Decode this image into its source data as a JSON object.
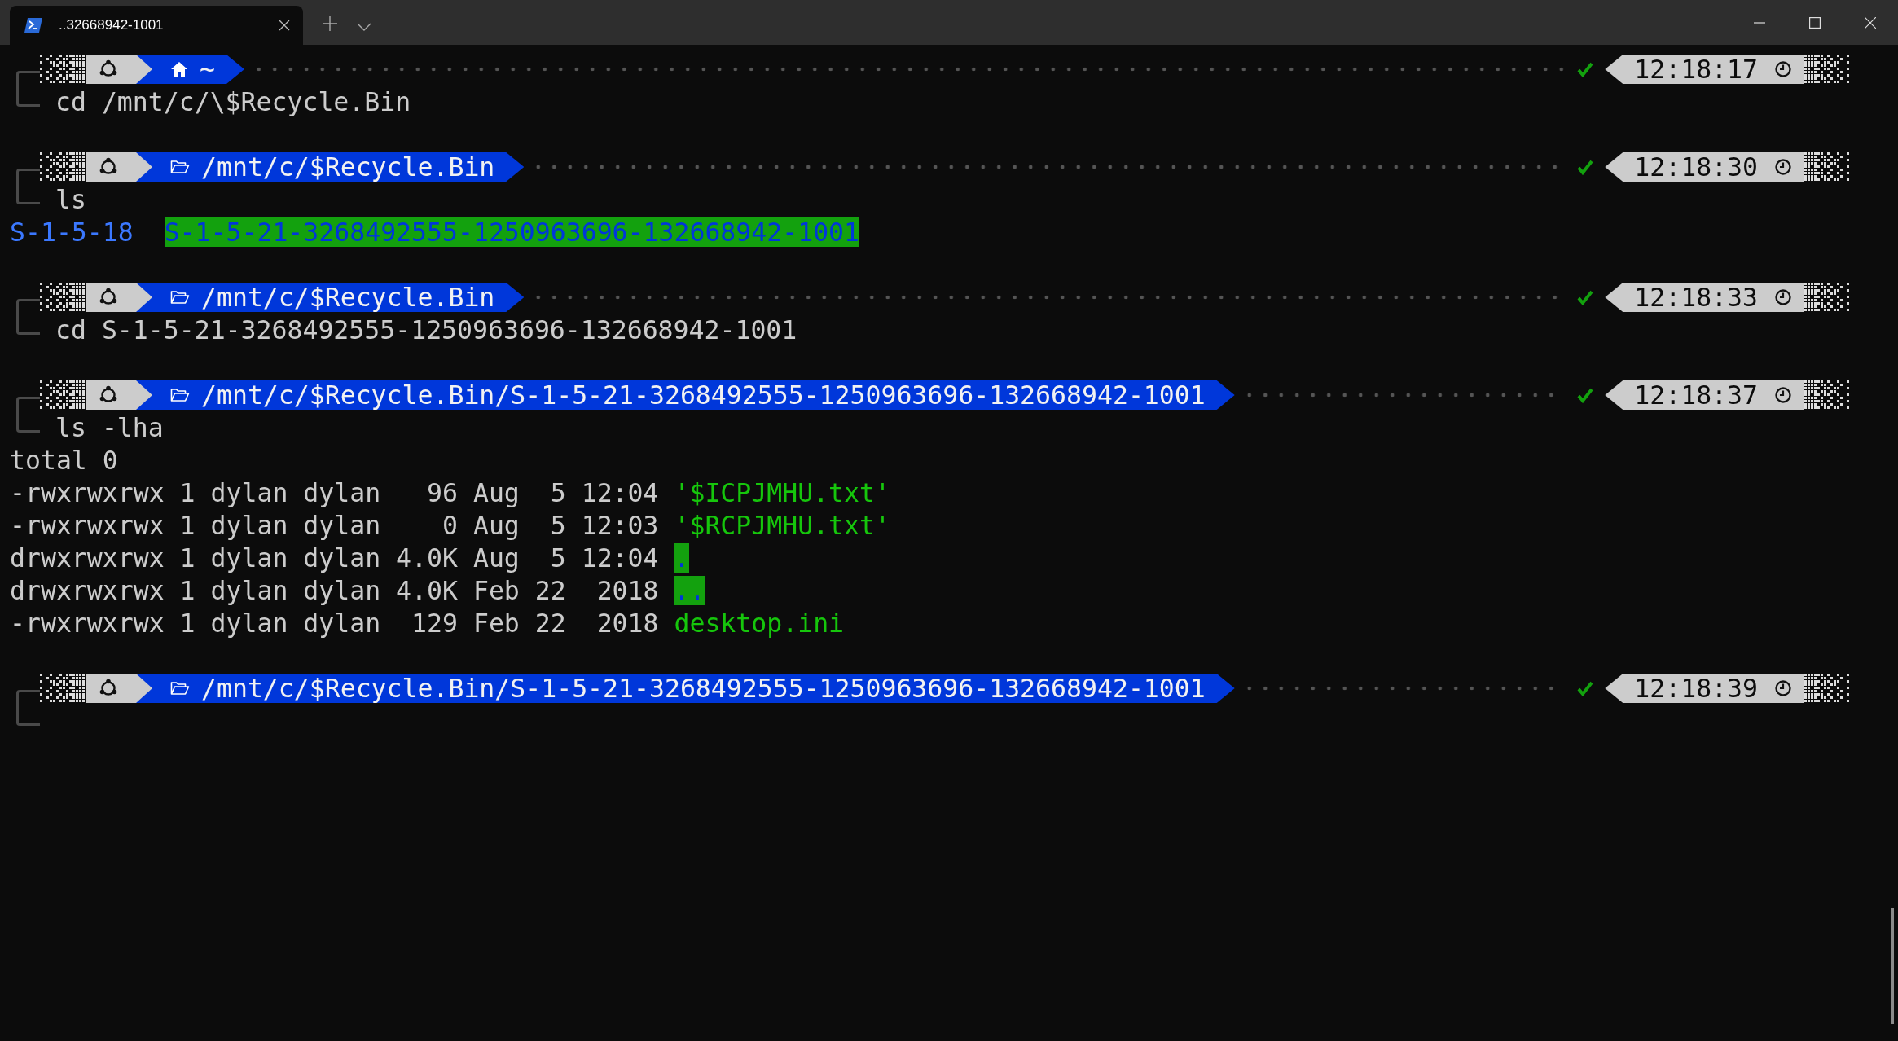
{
  "tab": {
    "title": "..32668942-1001"
  },
  "blocks": [
    {
      "location": {
        "kind": "home",
        "text": "~"
      },
      "success": true,
      "time": "12:18:17",
      "command": "cd /mnt/c/\\$Recycle.Bin"
    },
    {
      "location": {
        "kind": "folder",
        "text": "/mnt/c/$Recycle.Bin"
      },
      "success": true,
      "time": "12:18:30",
      "command": "ls",
      "output": [
        {
          "kind": "columns",
          "entries": [
            {
              "text": "S-1-5-18",
              "kind": "dir"
            },
            {
              "text": "S-1-5-21-3268492555-1250963696-132668942-1001",
              "kind": "sticky_dir"
            }
          ]
        }
      ]
    },
    {
      "location": {
        "kind": "folder",
        "text": "/mnt/c/$Recycle.Bin"
      },
      "success": true,
      "time": "12:18:33",
      "command": "cd S-1-5-21-3268492555-1250963696-132668942-1001"
    },
    {
      "location": {
        "kind": "folder",
        "text": "/mnt/c/$Recycle.Bin/S-1-5-21-3268492555-1250963696-132668942-1001"
      },
      "success": true,
      "time": "12:18:37",
      "command": "ls -lha",
      "output": [
        {
          "kind": "text",
          "text": "total 0"
        },
        {
          "kind": "long",
          "info": "-rwxrwxrwx 1 dylan dylan   96 Aug  5 12:04",
          "name": {
            "text": "'$ICPJMHU.txt'",
            "kind": "file"
          }
        },
        {
          "kind": "long",
          "info": "-rwxrwxrwx 1 dylan dylan    0 Aug  5 12:03",
          "name": {
            "text": "'$RCPJMHU.txt'",
            "kind": "file"
          }
        },
        {
          "kind": "long",
          "info": "drwxrwxrwx 1 dylan dylan 4.0K Aug  5 12:04",
          "name": {
            "text": ".",
            "kind": "sticky_dir"
          }
        },
        {
          "kind": "long",
          "info": "drwxrwxrwx 1 dylan dylan 4.0K Feb 22  2018",
          "name": {
            "text": "..",
            "kind": "sticky_dir"
          }
        },
        {
          "kind": "long",
          "info": "-rwxrwxrwx 1 dylan dylan  129 Feb 22  2018",
          "name": {
            "text": "desktop.ini",
            "kind": "file"
          }
        }
      ]
    },
    {
      "location": {
        "kind": "folder",
        "text": "/mnt/c/$Recycle.Bin/S-1-5-21-3268492555-1250963696-132668942-1001"
      },
      "success": true,
      "time": "12:18:39"
    }
  ]
}
